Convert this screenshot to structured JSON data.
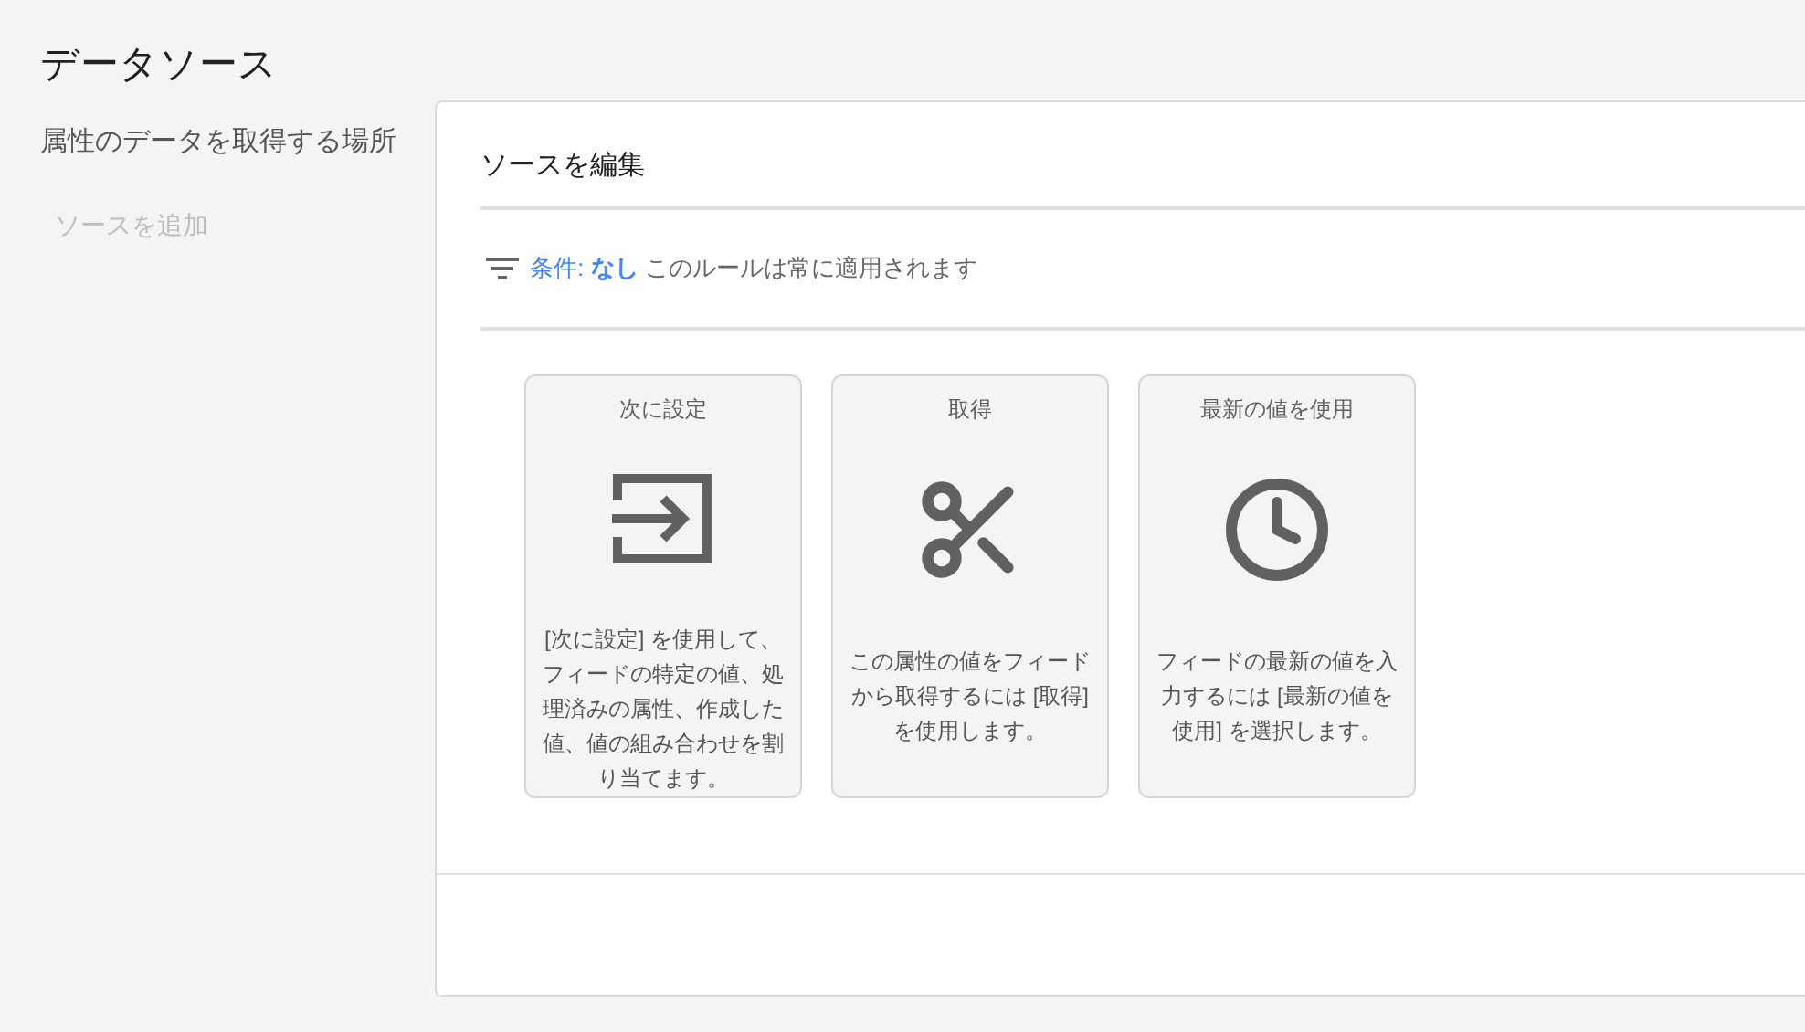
{
  "page_title": "データソース",
  "sidebar": {
    "heading": "属性のデータを取得する場所",
    "add_link": {
      "label": "ソースを追加",
      "disabled": true
    }
  },
  "panel": {
    "title": "ソースを編集",
    "condition": {
      "label": "条件:",
      "value": "なし",
      "description": "このルールは常に適用されます"
    },
    "options": [
      {
        "kind": "set",
        "title": "次に設定",
        "description": "[次に設定] を使用して、フィードの特定の値、処理済みの属性、作成した値、値の組み合わせを割り当てます。"
      },
      {
        "kind": "extract",
        "title": "取得",
        "description": "この属性の値をフィードから取得するには [取得] を使用します。"
      },
      {
        "kind": "latest",
        "title": "最新の値を使用",
        "description": "フィードの最新の値を入力するには [最新の値を使用] を選択します。"
      }
    ]
  }
}
